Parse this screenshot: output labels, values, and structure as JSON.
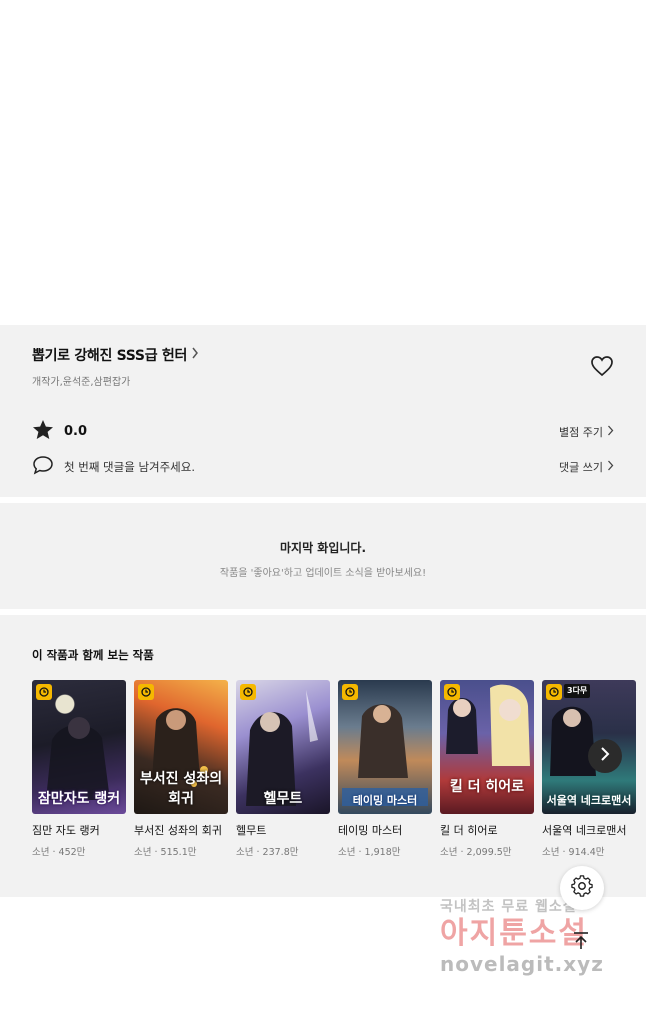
{
  "series": {
    "title": "뽑기로 강해진 SSS급 헌터",
    "authors": "개작가,윤석준,삼편잡가"
  },
  "rating": {
    "value": "0.0",
    "rate_label": "별점 주기"
  },
  "comments": {
    "prompt": "첫 번째 댓글을 남겨주세요.",
    "write_label": "댓글 쓰기"
  },
  "last_episode": {
    "title": "마지막 화입니다.",
    "subtitle": "작품을 '좋아요'하고 업데이트 소식을 받아보세요!"
  },
  "recommend": {
    "heading": "이 작품과 함께 보는 작품",
    "items": [
      {
        "title": "짐만 자도 랭커",
        "meta": "소년 · 452만",
        "cover_text": "잠만자도 랭커",
        "badge": ""
      },
      {
        "title": "부서진 성좌의 회귀",
        "meta": "소년 · 515.1만",
        "cover_text": "부서진 성좌의 회귀",
        "badge": ""
      },
      {
        "title": "헬무트",
        "meta": "소년 · 237.8만",
        "cover_text": "헬무트",
        "badge": ""
      },
      {
        "title": "테이밍 마스터",
        "meta": "소년 · 1,918만",
        "cover_text": "테이밍 마스터",
        "badge": ""
      },
      {
        "title": "킬 더 히어로",
        "meta": "소년 · 2,099.5만",
        "cover_text": "킬 더 히어로",
        "badge": ""
      },
      {
        "title": "서울역 네크로맨서",
        "meta": "소년 · 914.4만",
        "cover_text": "서울역 네크로맨서",
        "badge": "3다무"
      }
    ]
  },
  "watermark": {
    "line1": "국내최초 무료 웹소설",
    "line2": "아지툰소설",
    "line3": "novelagit.xyz"
  },
  "icons": {
    "heart": "heart-icon",
    "star": "star-icon",
    "comment": "comment-icon",
    "chevron": "chevron-right-icon",
    "clock": "clock-icon",
    "gear": "gear-icon",
    "top": "arrow-up-icon"
  },
  "colors": {
    "panel_bg": "#f2f2f2",
    "badge": "#f5b800",
    "text": "#111111"
  }
}
